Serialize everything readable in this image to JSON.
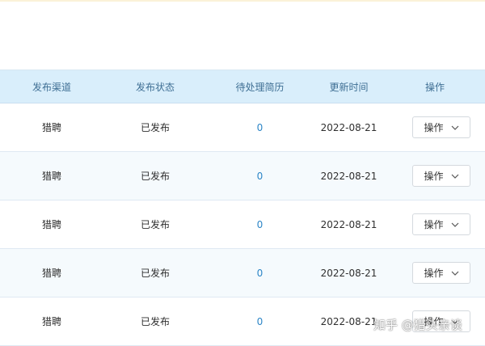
{
  "colors": {
    "header_bg": "#d9eefb",
    "header_text": "#3f6f94",
    "count_link": "#2d86c7",
    "row_alt_bg": "#f5fafd"
  },
  "table": {
    "headers": [
      "发布渠道",
      "发布状态",
      "待处理简历",
      "更新时间",
      "操作"
    ],
    "rows": [
      {
        "channel": "猎聘",
        "status": "已发布",
        "pending": "0",
        "updated": "2022-08-21",
        "action": "操作"
      },
      {
        "channel": "猎聘",
        "status": "已发布",
        "pending": "0",
        "updated": "2022-08-21",
        "action": "操作"
      },
      {
        "channel": "猎聘",
        "status": "已发布",
        "pending": "0",
        "updated": "2022-08-21",
        "action": "操作"
      },
      {
        "channel": "猎聘",
        "status": "已发布",
        "pending": "0",
        "updated": "2022-08-21",
        "action": "操作"
      },
      {
        "channel": "猎聘",
        "status": "已发布",
        "pending": "0",
        "updated": "2022-08-21",
        "action": "操作"
      }
    ]
  },
  "watermark": {
    "text": "知乎 @猎头亲谈"
  }
}
